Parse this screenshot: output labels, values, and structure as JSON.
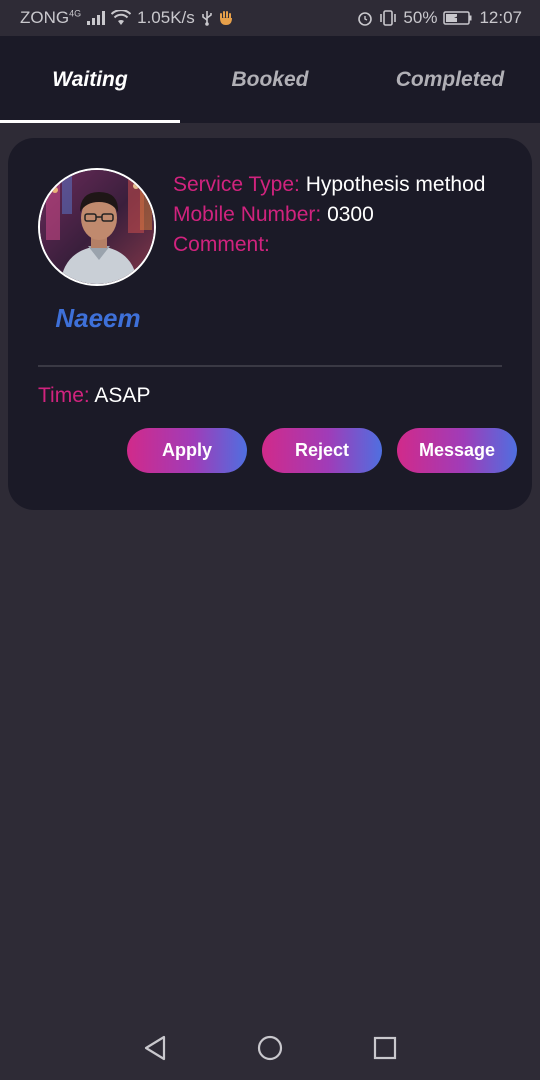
{
  "status_bar": {
    "carrier": "ZONG",
    "network": "4G",
    "speed": "1.05K/s",
    "battery": "50%",
    "time": "12:07"
  },
  "tabs": [
    {
      "label": "Waiting",
      "active": true
    },
    {
      "label": "Booked",
      "active": false
    },
    {
      "label": "Completed",
      "active": false
    }
  ],
  "card": {
    "name": "Naeem",
    "service_type_label": "Service Type:",
    "service_type_value": "Hypothesis method",
    "mobile_label": "Mobile Number:",
    "mobile_value": "0300",
    "comment_label": "Comment:",
    "comment_value": "",
    "time_label": "Time:",
    "time_value": "ASAP",
    "buttons": {
      "apply": "Apply",
      "reject": "Reject",
      "message": "Message"
    }
  },
  "colors": {
    "accent_label": "#d0237e",
    "name": "#3e70d8",
    "card_bg": "#1b1a27",
    "page_bg": "#2e2b36"
  }
}
